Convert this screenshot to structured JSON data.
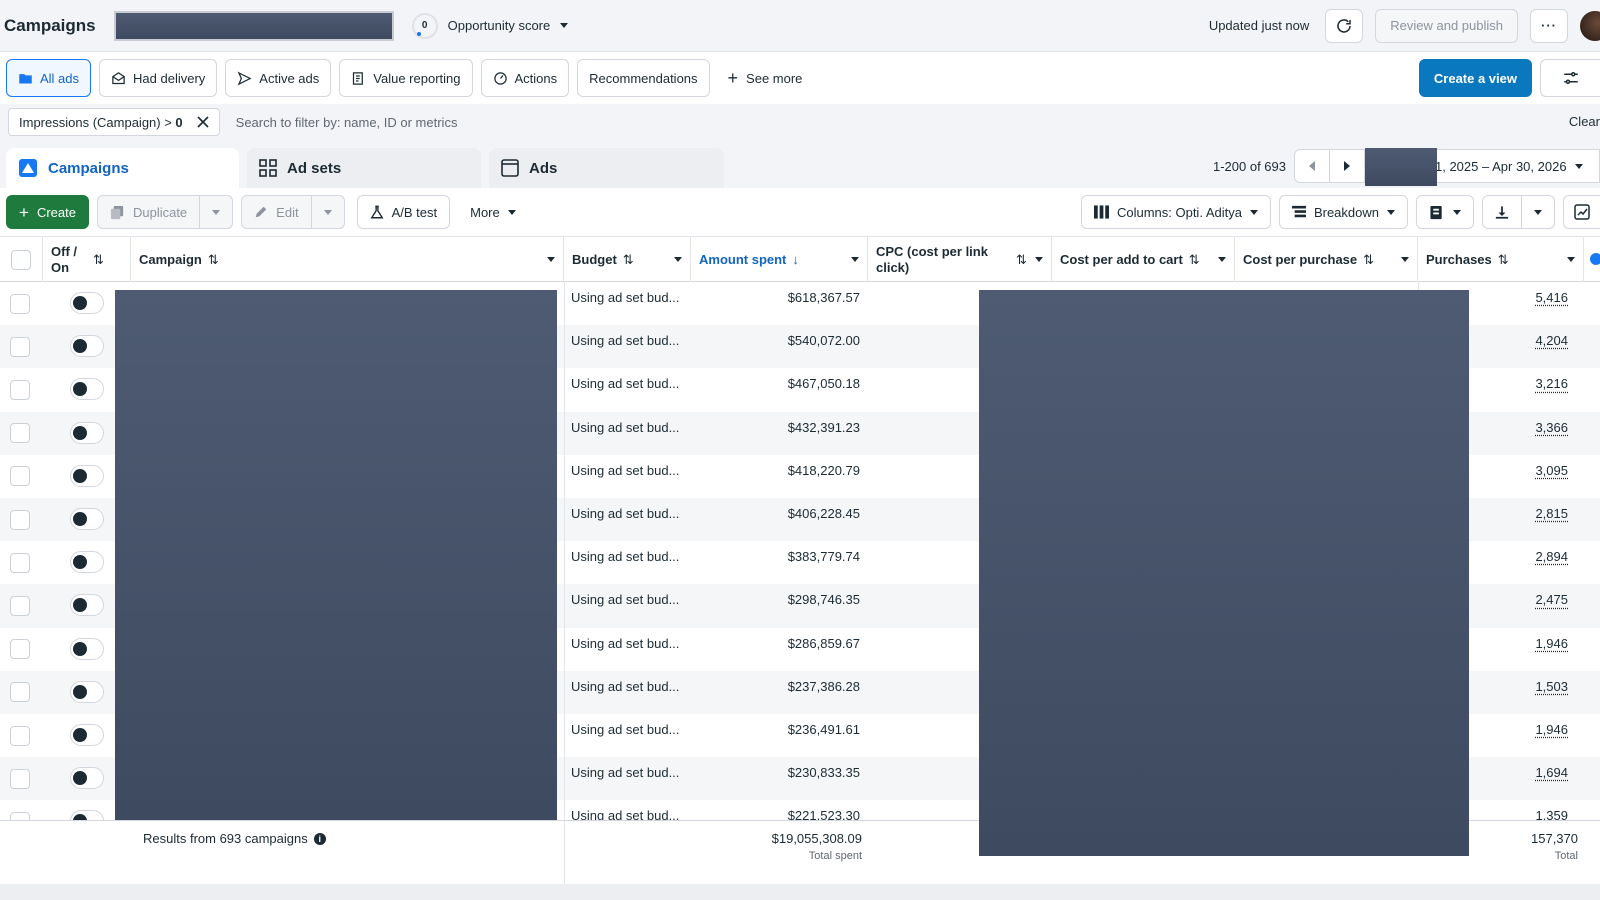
{
  "header": {
    "title": "Campaigns",
    "opportunity_value": "0",
    "opportunity_label": "Opportunity score",
    "updated_text": "Updated just now",
    "review_publish": "Review and publish",
    "more_label": "···"
  },
  "views": {
    "items": [
      {
        "label": "All ads",
        "icon": "folder-icon"
      },
      {
        "label": "Had delivery",
        "icon": "envelope-icon"
      },
      {
        "label": "Active ads",
        "icon": "send-icon"
      },
      {
        "label": "Value reporting",
        "icon": "report-icon"
      },
      {
        "label": "Actions",
        "icon": "gauge-icon"
      },
      {
        "label": "Recommendations",
        "icon": ""
      }
    ],
    "see_more": "See more",
    "create_view": "Create a view"
  },
  "filter": {
    "chip_text": "Impressions (Campaign) > ",
    "chip_value": "0",
    "search_placeholder": "Search to filter by: name, ID or metrics",
    "clear": "Clear"
  },
  "level_tabs": {
    "campaigns": "Campaigns",
    "ad_sets": "Ad sets",
    "ads": "Ads"
  },
  "pager": {
    "count": "1-200 of 693",
    "date_range": "1, 2025 – Apr 30, 2026"
  },
  "toolbar": {
    "create": "Create",
    "duplicate": "Duplicate",
    "edit": "Edit",
    "ab_test": "A/B test",
    "more": "More",
    "columns": "Columns: Opti. Aditya",
    "breakdown": "Breakdown"
  },
  "table": {
    "headers": {
      "off_on": "Off / On",
      "campaign": "Campaign",
      "budget": "Budget",
      "amount_spent": "Amount spent",
      "cpc": "CPC (cost per link click)",
      "cost_add_to_cart": "Cost per add to cart",
      "cost_purchase": "Cost per purchase",
      "purchases": "Purchases"
    },
    "rows": [
      {
        "budget": "Using ad set bud...",
        "spent": "$618,367.57",
        "purchases": "5,416"
      },
      {
        "budget": "Using ad set bud...",
        "spent": "$540,072.00",
        "purchases": "4,204"
      },
      {
        "budget": "Using ad set bud...",
        "spent": "$467,050.18",
        "purchases": "3,216"
      },
      {
        "budget": "Using ad set bud...",
        "spent": "$432,391.23",
        "purchases": "3,366"
      },
      {
        "budget": "Using ad set bud...",
        "spent": "$418,220.79",
        "purchases": "3,095"
      },
      {
        "budget": "Using ad set bud...",
        "spent": "$406,228.45",
        "purchases": "2,815"
      },
      {
        "budget": "Using ad set bud...",
        "spent": "$383,779.74",
        "purchases": "2,894"
      },
      {
        "budget": "Using ad set bud...",
        "spent": "$298,746.35",
        "purchases": "2,475"
      },
      {
        "budget": "Using ad set bud...",
        "spent": "$286,859.67",
        "purchases": "1,946"
      },
      {
        "budget": "Using ad set bud...",
        "spent": "$237,386.28",
        "purchases": "1,503"
      },
      {
        "budget": "Using ad set bud...",
        "spent": "$236,491.61",
        "purchases": "1,946"
      },
      {
        "budget": "Using ad set bud...",
        "spent": "$230,833.35",
        "purchases": "1,694"
      },
      {
        "budget": "Using ad set bud...",
        "spent": "$221,523.30",
        "purchases": "1,359"
      }
    ],
    "footer": {
      "results": "Results from 693 campaigns",
      "total_spent": "$19,055,308.09",
      "total_spent_label": "Total spent",
      "total_purchases": "157,370",
      "total_purchases_label": "Total"
    }
  },
  "colors": {
    "accent_blue": "#0a78be",
    "create_green": "#1f7a3d",
    "redaction": "#465268"
  }
}
